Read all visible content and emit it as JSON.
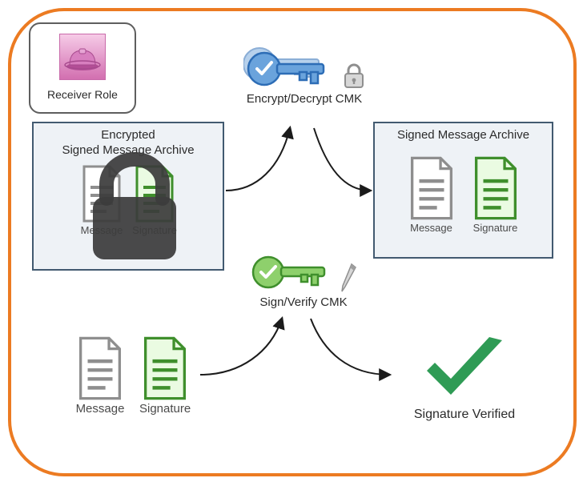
{
  "role": {
    "label": "Receiver Role",
    "icon": "hardhat-icon"
  },
  "encryptedArchive": {
    "title_line1": "Encrypted",
    "title_line2": "Signed Message Archive",
    "message_label": "Message",
    "signature_label": "Signature"
  },
  "signedArchive": {
    "title": "Signed Message Archive",
    "message_label": "Message",
    "signature_label": "Signature"
  },
  "cmk": {
    "encrypt_label": "Encrypt/Decrypt CMK",
    "sign_label": "Sign/Verify CMK"
  },
  "bottom": {
    "message_label": "Message",
    "signature_label": "Signature"
  },
  "verified": {
    "label": "Signature Verified"
  },
  "colors": {
    "orange": "#ec7b22",
    "panel_bg": "#eef2f6",
    "panel_border": "#425a70",
    "blue_key": "#4b8fd6",
    "blue_key_dark": "#2d6db6",
    "green_key": "#6fbf4a",
    "green_key_dark": "#3f8f2c",
    "doc_gray": "#8e8e8e",
    "doc_green": "#6cbf4a",
    "lock": "#3c3c3c",
    "check": "#2f9b55"
  }
}
